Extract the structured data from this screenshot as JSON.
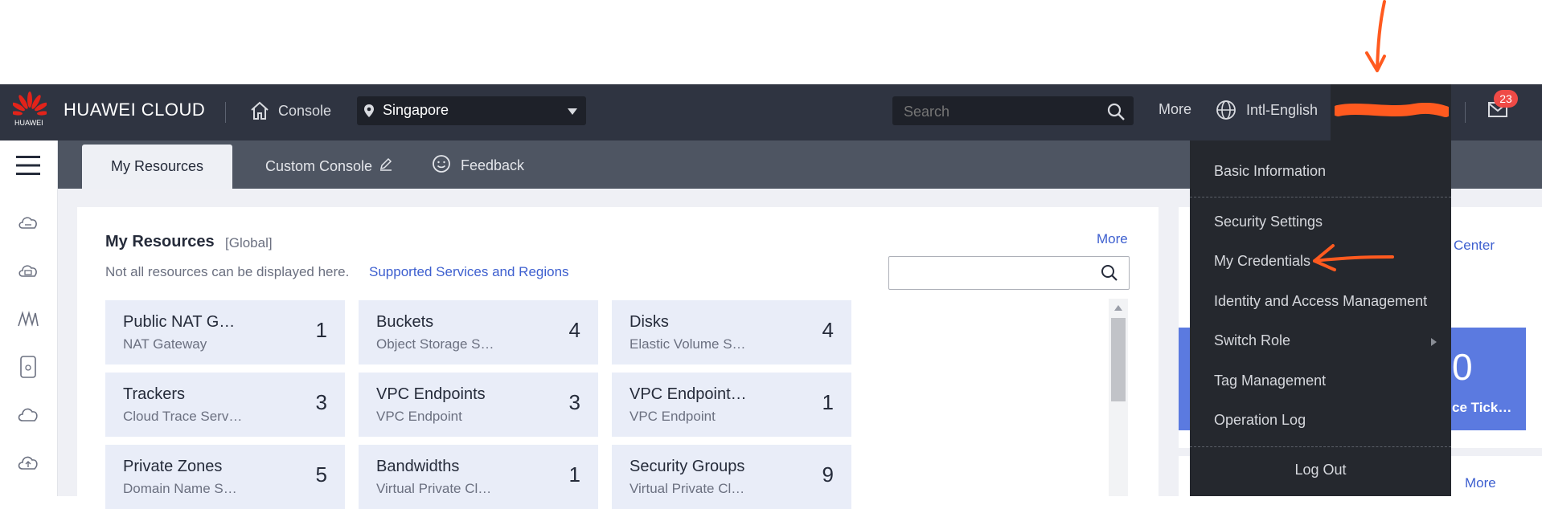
{
  "header": {
    "logo_sub": "HUAWEI",
    "brand": "HUAWEI CLOUD",
    "console": "Console",
    "region": "Singapore",
    "search_placeholder": "Search",
    "more": "More",
    "language": "Intl-English",
    "mail_count": "23"
  },
  "tabs": {
    "my_resources": "My Resources",
    "custom_console": "Custom Console",
    "feedback": "Feedback"
  },
  "resources": {
    "title": "My Resources",
    "scope": "[Global]",
    "more": "More",
    "note": "Not all resources can be displayed here.",
    "note_link": "Supported Services and Regions",
    "tiles": [
      {
        "name": "Public NAT G…",
        "service": "NAT Gateway",
        "count": "1"
      },
      {
        "name": "Buckets",
        "service": "Object Storage S…",
        "count": "4"
      },
      {
        "name": "Disks",
        "service": "Elastic Volume S…",
        "count": "4"
      },
      {
        "name": "Trackers",
        "service": "Cloud Trace Serv…",
        "count": "3"
      },
      {
        "name": "VPC Endpoints",
        "service": "VPC Endpoint",
        "count": "3"
      },
      {
        "name": "VPC Endpoint…",
        "service": "VPC Endpoint",
        "count": "1"
      },
      {
        "name": "Private Zones",
        "service": "Domain Name S…",
        "count": "5"
      },
      {
        "name": "Bandwidths",
        "service": "Virtual Private Cl…",
        "count": "1"
      },
      {
        "name": "Security Groups",
        "service": "Virtual Private Cl…",
        "count": "9"
      }
    ]
  },
  "right_panel": {
    "center_link": "Center",
    "ticket_count": "0",
    "ticket_label": "ce Tick…",
    "more": "More"
  },
  "account_menu": {
    "items": [
      "Basic Information",
      "Security Settings",
      "My Credentials",
      "Identity and Access Management",
      "Switch Role",
      "Tag Management",
      "Operation Log"
    ],
    "logout": "Log Out"
  },
  "colors": {
    "topbar": "#2f3441",
    "menu_bg": "#25282e",
    "annotation": "#ff5a1f",
    "link": "#3d5fcf",
    "tile_bg": "#e9edf8"
  }
}
